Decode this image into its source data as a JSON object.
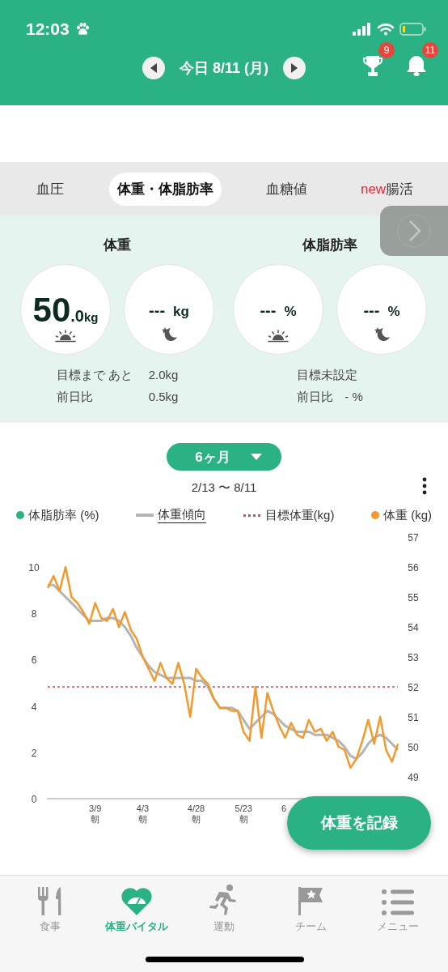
{
  "status_bar": {
    "time": "12:03"
  },
  "date_nav": {
    "label": "今日 8/11 (月)"
  },
  "header_badges": [
    {
      "kind": "trophy",
      "count": "9"
    },
    {
      "kind": "bell",
      "count": "11"
    }
  ],
  "tabs": [
    {
      "label": "血圧",
      "selected": false
    },
    {
      "label": "体重・体脂肪率",
      "selected": true
    },
    {
      "label": "血糖値",
      "selected": false
    },
    {
      "label": "腸活",
      "badge": "new",
      "selected": false
    }
  ],
  "metrics": [
    {
      "title": "体重",
      "readings": [
        {
          "value": "50",
          "decimal": ".0",
          "unit": "kg",
          "kind": "morning"
        },
        {
          "value": "---",
          "unit": "kg",
          "kind": "night"
        }
      ],
      "lines": [
        {
          "label": "目標まで あと",
          "value": "2.0kg"
        },
        {
          "label": "前日比",
          "value": "0.5kg"
        }
      ]
    },
    {
      "title": "体脂肪率",
      "readings": [
        {
          "value": "---",
          "unit": "%",
          "kind": "morning"
        },
        {
          "value": "---",
          "unit": "%",
          "kind": "night"
        }
      ],
      "lines": [
        {
          "label": "目標未設定"
        },
        {
          "label": "前日比",
          "value": "- %"
        }
      ]
    }
  ],
  "period": {
    "label": "6ヶ月"
  },
  "range": "2/13 〜 8/11",
  "legend": [
    {
      "label": "体脂肪率 (%)",
      "kind": "dot",
      "color": "#2bb284",
      "selected": false
    },
    {
      "label": "体重傾向",
      "kind": "line",
      "color": "#b4b4b4",
      "selected": true
    },
    {
      "label": "目標体重(kg)",
      "kind": "dotted",
      "color": "#e04848",
      "selected": false
    },
    {
      "label": "体重 (kg)",
      "kind": "dot",
      "color": "#f39a2e",
      "selected": false
    }
  ],
  "chart": {
    "left_axis_ticks": [
      "10",
      "8",
      "6",
      "4",
      "2",
      "0"
    ],
    "partial_tick_label": "6",
    "chart_data": {
      "type": "line",
      "ylim": [
        49,
        57
      ],
      "yticks": [
        49,
        50,
        51,
        52,
        53,
        54,
        55,
        56,
        57
      ],
      "categories": [
        null,
        null,
        null,
        null,
        null,
        null,
        null,
        null,
        "3/9 朝",
        null,
        null,
        null,
        null,
        null,
        null,
        null,
        "4/3 朝",
        null,
        null,
        null,
        null,
        null,
        null,
        null,
        null,
        "4/28 朝",
        null,
        null,
        null,
        null,
        null,
        null,
        null,
        "5/23 朝",
        null,
        null,
        null,
        null,
        null,
        null,
        null,
        null,
        null,
        null,
        null,
        null,
        null,
        null,
        null,
        null,
        null,
        null,
        null,
        null,
        null,
        null,
        null,
        null,
        null,
        null
      ],
      "series": [
        {
          "color": "#b4b4b4",
          "values": [
            55.4,
            55.4,
            55.2,
            55.0,
            54.8,
            54.6,
            54.4,
            54.2,
            54.2,
            54.2,
            54.3,
            54.3,
            54.2,
            54.0,
            53.7,
            53.3,
            53.0,
            52.7,
            52.5,
            52.4,
            52.3,
            52.3,
            52.3,
            52.3,
            52.3,
            52.2,
            52.2,
            52.0,
            51.6,
            51.3,
            51.3,
            51.3,
            51.2,
            50.9,
            50.6,
            50.8,
            51.0,
            51.2,
            51.1,
            50.9,
            50.7,
            50.6,
            50.5,
            50.5,
            50.5,
            50.4,
            50.4,
            50.4,
            50.3,
            50.2,
            50.0,
            49.7,
            49.6,
            49.8,
            50.1,
            50.3,
            50.4,
            50.3,
            50.1,
            49.9
          ]
        },
        {
          "color": "#e04848",
          "line_style": "dotted",
          "values": [
            52,
            52,
            52,
            52,
            52,
            52,
            52,
            52,
            52,
            52,
            52,
            52,
            52,
            52,
            52,
            52,
            52,
            52,
            52,
            52,
            52,
            52,
            52,
            52,
            52,
            52,
            52,
            52,
            52,
            52,
            52,
            52,
            52,
            52,
            52,
            52,
            52,
            52,
            52,
            52,
            52,
            52,
            52,
            52,
            52,
            52,
            52,
            52,
            52,
            52,
            52,
            52,
            52,
            52,
            52,
            52,
            52,
            52,
            52,
            52
          ]
        },
        {
          "color": "#f39a2e",
          "values": [
            55.3,
            55.7,
            55.2,
            56.0,
            55.0,
            54.8,
            54.5,
            54.1,
            54.8,
            54.3,
            54.2,
            54.6,
            54.0,
            54.5,
            53.9,
            53.6,
            53.0,
            52.6,
            52.2,
            52.8,
            52.3,
            52.1,
            52.8,
            52.1,
            51.0,
            52.6,
            52.3,
            52.1,
            51.6,
            51.3,
            51.3,
            51.2,
            51.2,
            50.5,
            50.2,
            52.0,
            50.3,
            51.8,
            51.2,
            50.7,
            50.3,
            50.8,
            50.4,
            50.3,
            50.9,
            50.5,
            50.6,
            50.2,
            50.5,
            50.0,
            49.9,
            49.3,
            49.6,
            50.2,
            50.9,
            50.1,
            51.0,
            49.9,
            49.5,
            50.1
          ]
        }
      ]
    }
  },
  "fab": {
    "label": "体重を記録"
  },
  "bottom_nav": [
    {
      "label": "食事",
      "kind": "meal",
      "selected": false
    },
    {
      "label": "体重バイタル",
      "kind": "vital",
      "selected": true
    },
    {
      "label": "運動",
      "kind": "run",
      "selected": false
    },
    {
      "label": "チーム",
      "kind": "team",
      "selected": false
    },
    {
      "label": "メニュー",
      "kind": "menu",
      "selected": false
    }
  ]
}
